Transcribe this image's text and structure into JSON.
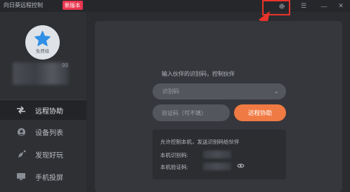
{
  "titlebar": {
    "app_title": "向日葵远程控制",
    "new_badge": "新版本",
    "gear_icon": "gear-icon",
    "menu_glyph": "☰",
    "min_glyph": "—",
    "close_glyph": "✕"
  },
  "profile": {
    "level_label": "免费级",
    "name_tail": "99"
  },
  "nav": {
    "items": [
      {
        "label": "远程协助",
        "icon": "remote-assist-icon"
      },
      {
        "label": "设备列表",
        "icon": "device-list-icon"
      },
      {
        "label": "发现好玩",
        "icon": "discover-icon"
      },
      {
        "label": "手机投屏",
        "icon": "screen-cast-icon"
      }
    ]
  },
  "main": {
    "prompt": "输入伙伴的识别码，控制伙伴",
    "select_placeholder": "识别码",
    "code_placeholder": "验证码（可不填）",
    "connect_label": "远程协助",
    "allow_title": "允许控制本机，发送识别码给伙伴",
    "device_id_label": "本机识别码:",
    "device_code_label": "本机验证码:"
  },
  "colors": {
    "accent": "#f07a43",
    "badge": "#e8364f",
    "highlight": "#e8332a"
  }
}
